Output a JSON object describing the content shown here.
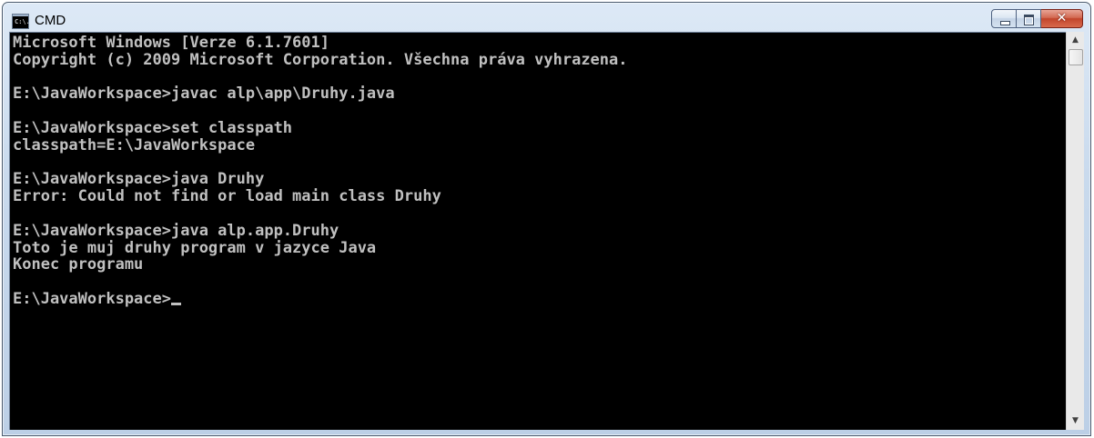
{
  "window": {
    "title": "CMD",
    "icon": "console-icon",
    "icon_text": "C:\\."
  },
  "controls": {
    "minimize": "minimize-icon",
    "maximize": "maximize-icon",
    "close": "✕"
  },
  "console": {
    "lines": [
      "Microsoft Windows [Verze 6.1.7601]",
      "Copyright (c) 2009 Microsoft Corporation. Všechna práva vyhrazena.",
      "",
      "E:\\JavaWorkspace>javac alp\\app\\Druhy.java",
      "",
      "E:\\JavaWorkspace>set classpath",
      "classpath=E:\\JavaWorkspace",
      "",
      "E:\\JavaWorkspace>java Druhy",
      "Error: Could not find or load main class Druhy",
      "",
      "E:\\JavaWorkspace>java alp.app.Druhy",
      "Toto je muj druhy program v jazyce Java",
      "Konec programu",
      ""
    ],
    "prompt": "E:\\JavaWorkspace>"
  },
  "scrollbar": {
    "up": "▲",
    "down": "▼"
  },
  "colors": {
    "console_bg": "#000000",
    "console_fg": "#c0c0c0",
    "close_button": "#c2452c"
  }
}
